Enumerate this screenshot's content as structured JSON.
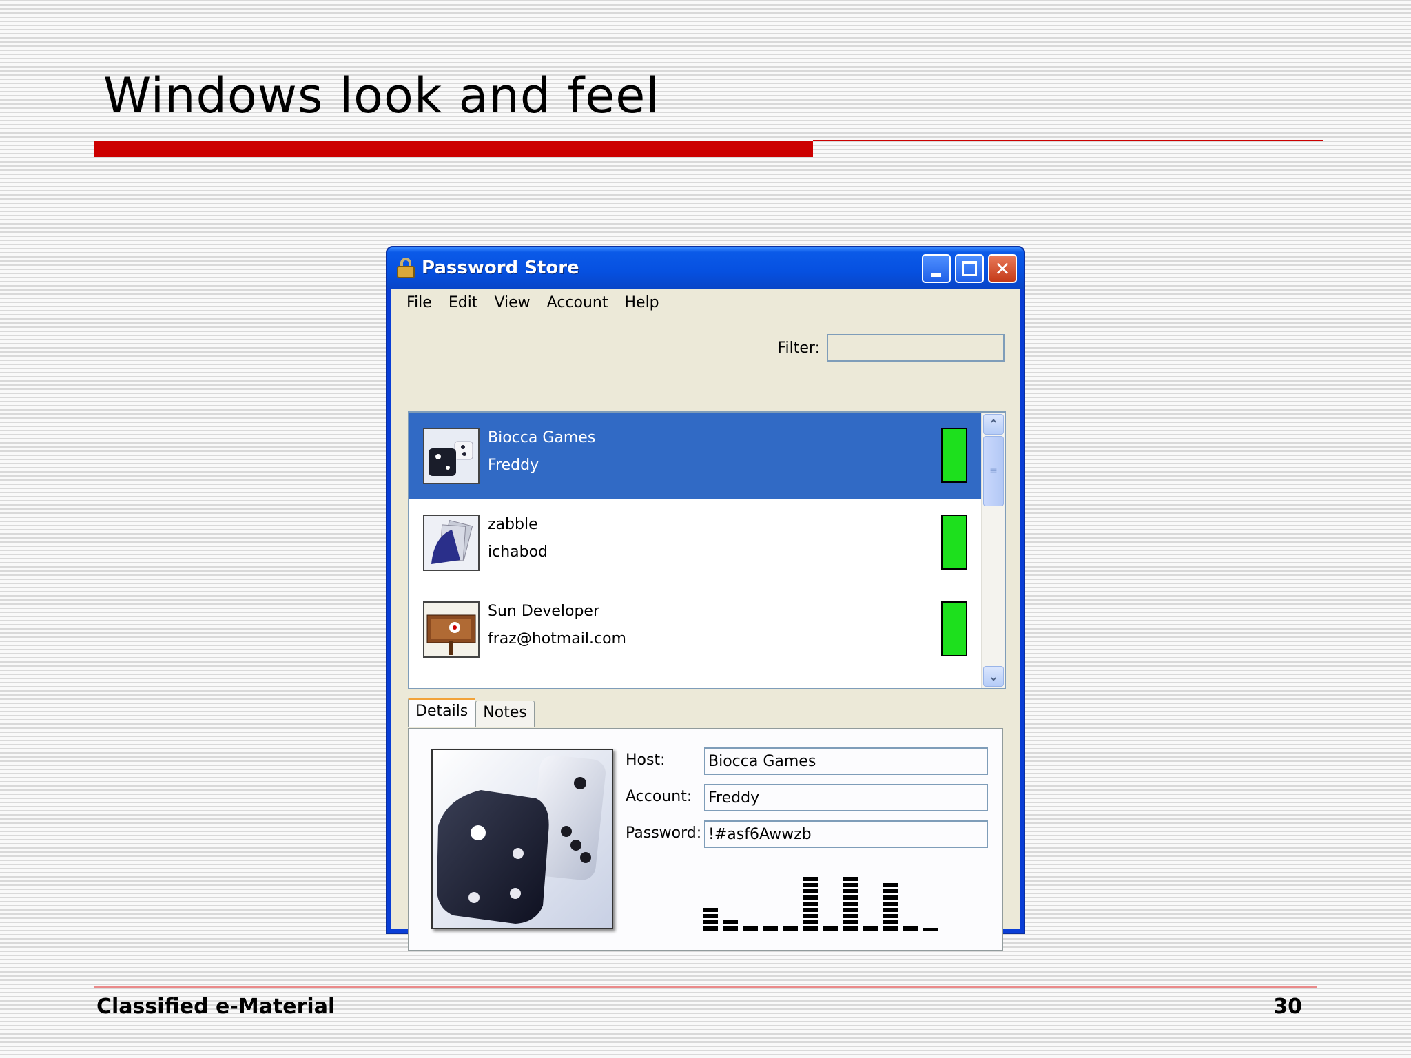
{
  "slide": {
    "title": "Windows look and feel",
    "footer_left": "Classified e-Material",
    "page_number": "30"
  },
  "window": {
    "title": "Password Store",
    "accent_color": "#0a3ed6",
    "selection_color": "#316ac5",
    "strength_color": "#1de01d"
  },
  "menu": [
    "File",
    "Edit",
    "View",
    "Account",
    "Help"
  ],
  "filter": {
    "label": "Filter:",
    "value": ""
  },
  "accounts": [
    {
      "host": "Biocca Games",
      "user": "Freddy",
      "icon": "dice-icon",
      "selected": true
    },
    {
      "host": "zabble",
      "user": "ichabod",
      "icon": "cards-icon",
      "selected": false
    },
    {
      "host": "Sun Developer",
      "user": "fraz@hotmail.com",
      "icon": "signpost-icon",
      "selected": false
    }
  ],
  "tabs": [
    "Details",
    "Notes"
  ],
  "details": {
    "host_label": "Host:",
    "host_value": "Biocca Games",
    "account_label": "Account:",
    "account_value": "Freddy",
    "password_label": "Password:",
    "password_value": "!#asf6Awwzb"
  }
}
